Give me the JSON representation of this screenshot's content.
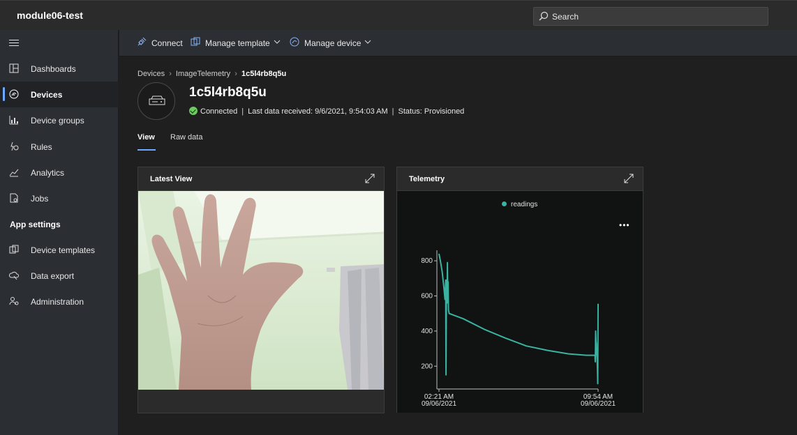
{
  "app": {
    "title": "module06-test"
  },
  "search": {
    "label": "Search"
  },
  "sidebar": {
    "items": [
      {
        "label": "Dashboards"
      },
      {
        "label": "Devices"
      },
      {
        "label": "Device groups"
      },
      {
        "label": "Rules"
      },
      {
        "label": "Analytics"
      },
      {
        "label": "Jobs"
      }
    ],
    "section_label": "App settings",
    "settings_items": [
      {
        "label": "Device templates"
      },
      {
        "label": "Data export"
      },
      {
        "label": "Administration"
      }
    ]
  },
  "commands": {
    "connect": "Connect",
    "manage_template": "Manage template",
    "manage_device": "Manage device"
  },
  "breadcrumb": {
    "root": "Devices",
    "template": "ImageTelemetry",
    "current": "1c5l4rb8q5u"
  },
  "device": {
    "name": "1c5l4rb8q5u",
    "connection": "Connected",
    "last_data": "Last data received: 9/6/2021, 9:54:03 AM",
    "status": "Status: Provisioned"
  },
  "tabs": {
    "view": "View",
    "raw": "Raw data"
  },
  "tiles": {
    "latest_view": {
      "title": "Latest View"
    },
    "telemetry": {
      "title": "Telemetry",
      "more": "•••"
    }
  },
  "colors": {
    "accent": "#6ea8fe",
    "series": "#3bb3a0",
    "connected": "#6ccb5f"
  },
  "chart_data": {
    "type": "line",
    "title": "Telemetry",
    "legend_position": "top-center",
    "series": [
      {
        "name": "readings",
        "x": [
          "02:21:00",
          "02:25:00",
          "02:30:00",
          "02:35:00",
          "02:38:00",
          "02:40:00",
          "02:41:00",
          "02:42:00",
          "02:43:00",
          "02:44:00",
          "02:45:00",
          "02:46:00",
          "02:47:00",
          "02:48:00",
          "02:50:00",
          "03:30:00",
          "04:30:00",
          "05:30:00",
          "06:30:00",
          "07:30:00",
          "08:30:00",
          "09:20:00",
          "09:45:00",
          "09:46:00",
          "09:47:00",
          "09:48:00",
          "09:49:00",
          "09:50:00",
          "09:51:00",
          "09:52:00",
          "09:53:00",
          "09:54:00"
        ],
        "values": [
          840,
          800,
          740,
          650,
          580,
          690,
          150,
          580,
          690,
          560,
          790,
          600,
          680,
          520,
          500,
          470,
          410,
          360,
          315,
          290,
          270,
          262,
          262,
          225,
          400,
          340,
          330,
          270,
          250,
          200,
          100,
          555
        ]
      }
    ],
    "x_tick_labels": [
      {
        "time": "02:21 AM",
        "date": "09/06/2021"
      },
      {
        "time": "09:54 AM",
        "date": "09/06/2021"
      }
    ],
    "y_ticks": [
      200,
      400,
      600,
      800
    ],
    "ylim": [
      70,
      860
    ],
    "grid": false
  }
}
